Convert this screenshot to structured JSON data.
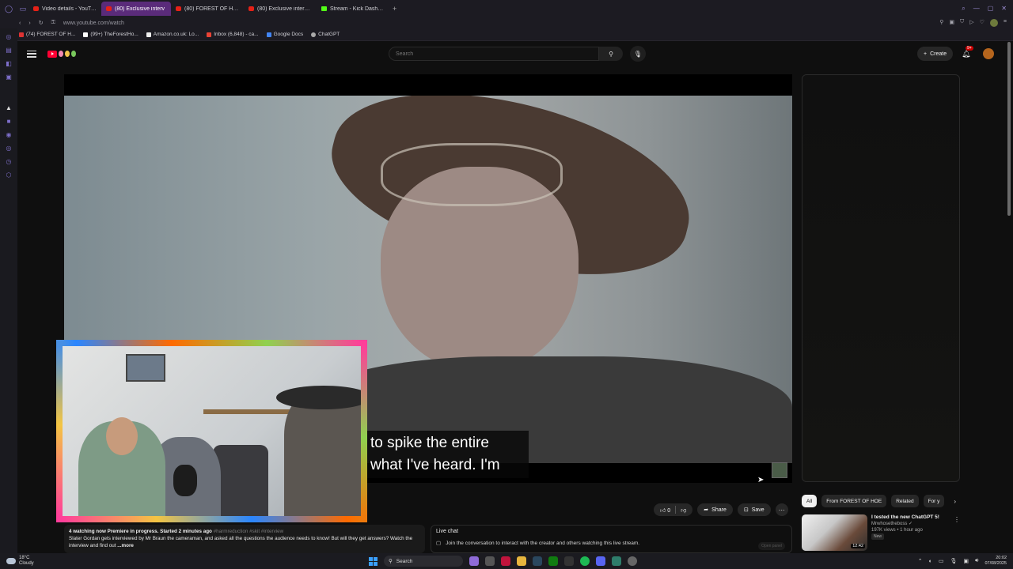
{
  "browser": {
    "tabs": [
      {
        "label": "Video details - YouTube S",
        "active": false,
        "favicon": "youtube-studio"
      },
      {
        "label": "(80) Exclusive interv",
        "active": true,
        "favicon": "youtube"
      },
      {
        "label": "(80) FOREST OF HOE - Yo",
        "active": false,
        "favicon": "youtube"
      },
      {
        "label": "(80) Exclusive interview",
        "active": false,
        "favicon": "youtube"
      },
      {
        "label": "Stream - Kick Dashboard",
        "active": false,
        "favicon": "kick"
      }
    ],
    "new_tab_icon": "+",
    "url": "www.youtube.com/watch",
    "bookmarks": [
      "(74) FOREST OF H...",
      "(99+) TheForestHo...",
      "Amazon.co.uk: Lo...",
      "Inbox (6,848) - ca...",
      "Google Docs",
      "ChatGPT"
    ]
  },
  "youtube": {
    "search_placeholder": "Search",
    "create_label": "Create",
    "notifications_badge": "9+",
    "video": {
      "caption_line1": "to spike the entire",
      "caption_line2": "what I've heard. I'm"
    },
    "actions": {
      "like_count": "0",
      "share_label": "Share",
      "save_label": "Save"
    },
    "description": {
      "meta": "4 watching now  Premiere in progress. Started 2 minutes ago",
      "tags": "#harmreduction #skit #interview",
      "text": "Slater Gordan gets interviewed by Mr Braun  the cameraman, and asked all the questions the audience needs to know! But will they get answers? Watch the interview and find out",
      "more": "...more"
    },
    "live_chat": {
      "title": "Live chat",
      "join_text": "Join the conversation to interact with the creator and others watching this live stream.",
      "open_button": "Open panel"
    },
    "chips": [
      "All",
      "From FOREST OF HOE",
      "Related",
      "For y"
    ],
    "recommendation": {
      "title": "I tested the new ChatGPT 5!",
      "channel": "Mrwhosetheboss",
      "views": "197K views • 1 hour ago",
      "badge": "New",
      "duration": "12:42"
    }
  },
  "taskbar": {
    "weather_temp": "18°C",
    "weather_desc": "Cloudy",
    "search_label": "Search",
    "time": "20:02",
    "date": "07/08/2025"
  }
}
